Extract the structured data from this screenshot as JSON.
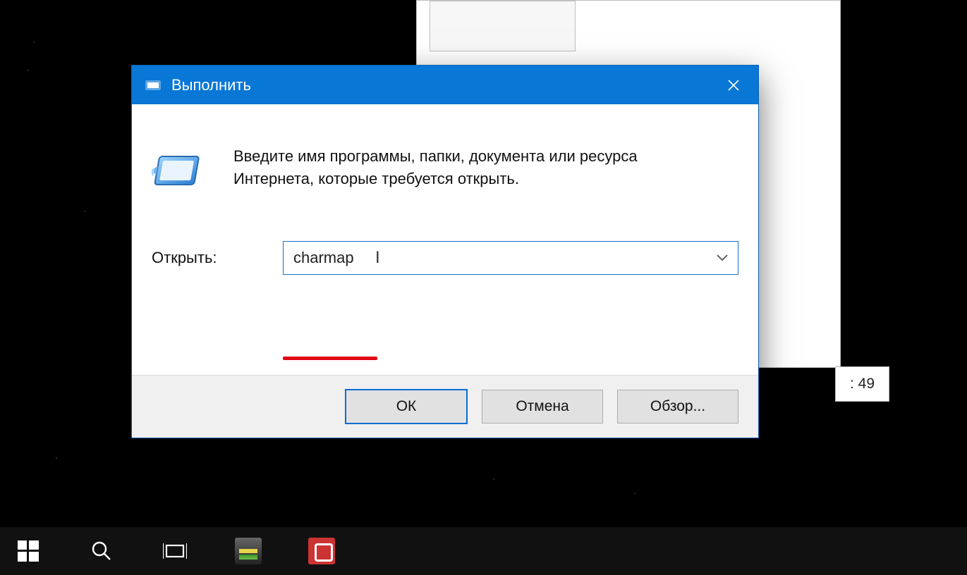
{
  "dialog": {
    "title": "Выполнить",
    "description": "Введите имя программы, папки, документа или ресурса Интернета, которые требуется открыть.",
    "open_label": "Открыть:",
    "input_value": "charmap",
    "buttons": {
      "ok": "ОК",
      "cancel": "Отмена",
      "browse": "Обзор..."
    }
  },
  "background": {
    "side_text": ": 49"
  }
}
